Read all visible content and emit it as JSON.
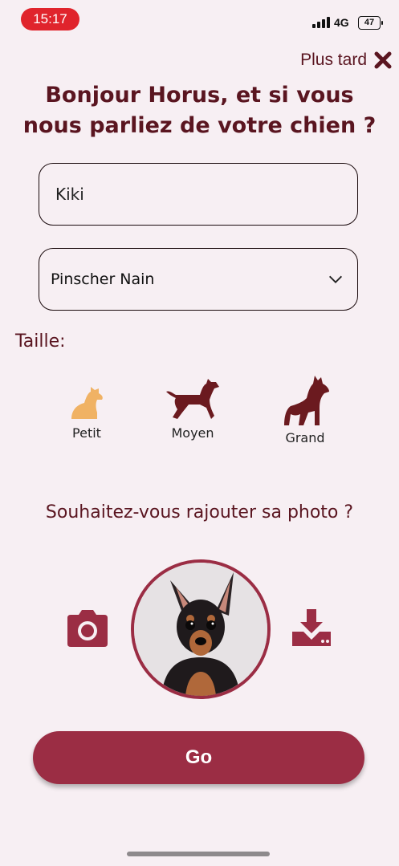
{
  "status_bar": {
    "time": "15:17",
    "network": "4G",
    "battery": "47"
  },
  "header": {
    "later_label": "Plus tard"
  },
  "title": "Bonjour Horus, et si vous nous parliez de votre chien ?",
  "form": {
    "name_value": "Kiki",
    "breed_selected": "Pinscher Nain"
  },
  "size": {
    "label": "Taille:",
    "options": [
      {
        "label": "Petit",
        "color": "#f0b264"
      },
      {
        "label": "Moyen",
        "color": "#6b1a1f"
      },
      {
        "label": "Grand",
        "color": "#6b1a1f"
      }
    ]
  },
  "photo": {
    "question": "Souhaitez-vous rajouter sa photo ?"
  },
  "actions": {
    "go_label": "Go"
  },
  "colors": {
    "accent": "#9b2d44",
    "background": "#f7eff3",
    "title": "#5a1520",
    "status_time": "#e0242c"
  }
}
